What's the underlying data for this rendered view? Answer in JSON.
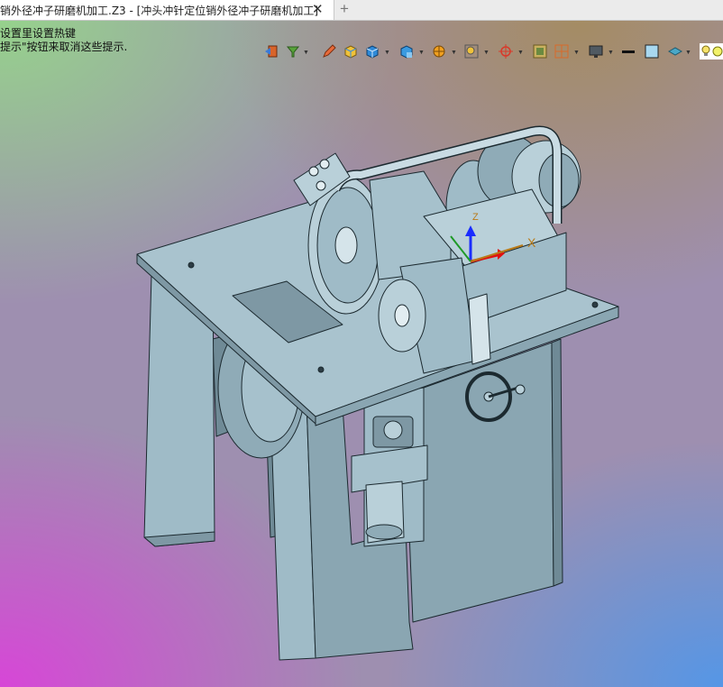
{
  "window": {
    "tab_title": "销外径冲子研磨机加工.Z3 - [冲头冲针定位销外径冲子研磨机加工]",
    "close_glyph": "✕",
    "new_tab_glyph": "+"
  },
  "hints": {
    "line1": "设置里设置热键",
    "line2": "提示\"按钮来取消这些提示."
  },
  "toolbar": {
    "icons": [
      "back-view-icon",
      "filter-icon",
      "pencil-icon",
      "shaded-box-icon",
      "cube-icon",
      "box-view-icon",
      "section-icon",
      "zoom-fit-icon",
      "crosshair-icon",
      "frame-icon",
      "grid-icon",
      "monitor-icon",
      "line-icon",
      "color-square-icon",
      "layer-icon",
      "lightbulb-icon"
    ]
  },
  "viewport": {
    "background": [
      "#9fd88f",
      "#a78f60",
      "#d646d8",
      "#5b98e5"
    ],
    "model_color": "#9fbbc7",
    "axis_labels": {
      "x": "X",
      "z": "Z"
    }
  }
}
